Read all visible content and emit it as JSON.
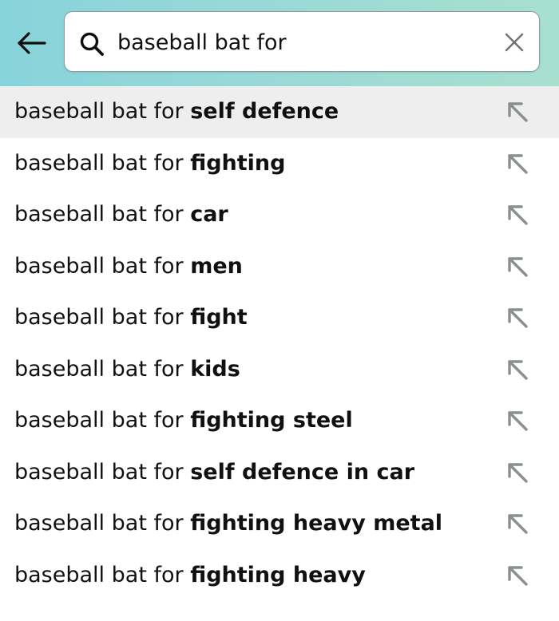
{
  "search": {
    "query": "baseball bat for",
    "back_icon": "back-arrow-icon",
    "search_icon": "search-icon",
    "clear_icon": "clear-icon"
  },
  "suggestions": [
    {
      "prefix": "baseball bat for ",
      "completion": "self defence",
      "highlighted": true
    },
    {
      "prefix": "baseball bat for ",
      "completion": "fighting"
    },
    {
      "prefix": "baseball bat for ",
      "completion": "car"
    },
    {
      "prefix": "baseball bat for ",
      "completion": "men"
    },
    {
      "prefix": "baseball bat for ",
      "completion": "fight"
    },
    {
      "prefix": "baseball bat for ",
      "completion": "kids"
    },
    {
      "prefix": "baseball bat for ",
      "completion": "fighting steel"
    },
    {
      "prefix": "baseball bat for ",
      "completion": "self defence in car"
    },
    {
      "prefix": "baseball bat for ",
      "completion": "fighting heavy metal"
    },
    {
      "prefix": "baseball bat for ",
      "completion": "fighting heavy"
    }
  ],
  "suggestion_icon": "fill-query-arrow-icon",
  "colors": {
    "header_gradient_start": "#87d3db",
    "header_gradient_end": "#a8e0cf",
    "highlight_row": "#eeeeee",
    "text": "#0f1111",
    "icon_gray": "#8a8f8f"
  }
}
